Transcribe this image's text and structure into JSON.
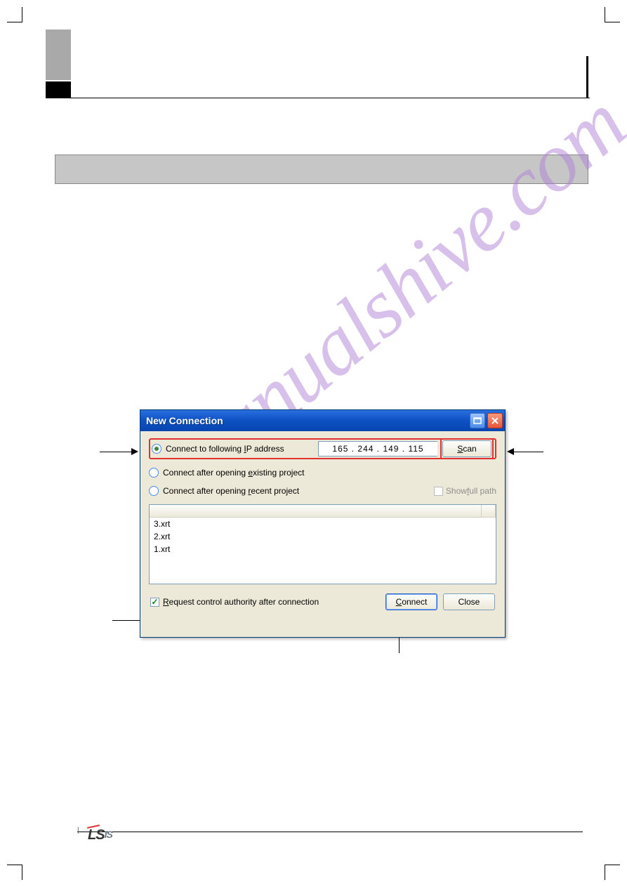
{
  "dialog": {
    "title": "New Connection",
    "radio1_label_pre": "Connect to following ",
    "radio1_label_u": "I",
    "radio1_label_post": "P address",
    "ip_value": "165  . 244  . 149  . 115",
    "scan_label_u": "S",
    "scan_label_post": "can",
    "radio2_label_pre": "Connect after opening ",
    "radio2_label_u": "e",
    "radio2_label_post": "xisting project",
    "radio3_label_pre": "Connect after opening ",
    "radio3_label_u": "r",
    "radio3_label_post": "ecent project",
    "show_full_label_pre": "Show ",
    "show_full_label_u": "f",
    "show_full_label_post": "ull path",
    "recent_items": [
      "3.xrt",
      "2.xrt",
      "1.xrt"
    ],
    "footer_chk_label_u": "R",
    "footer_chk_label_post": "equest control authority after connection",
    "connect_label_u": "C",
    "connect_label_post": "onnect",
    "close_label": "Close"
  },
  "footer_logo": {
    "ls": "LS",
    "is": "IS"
  }
}
